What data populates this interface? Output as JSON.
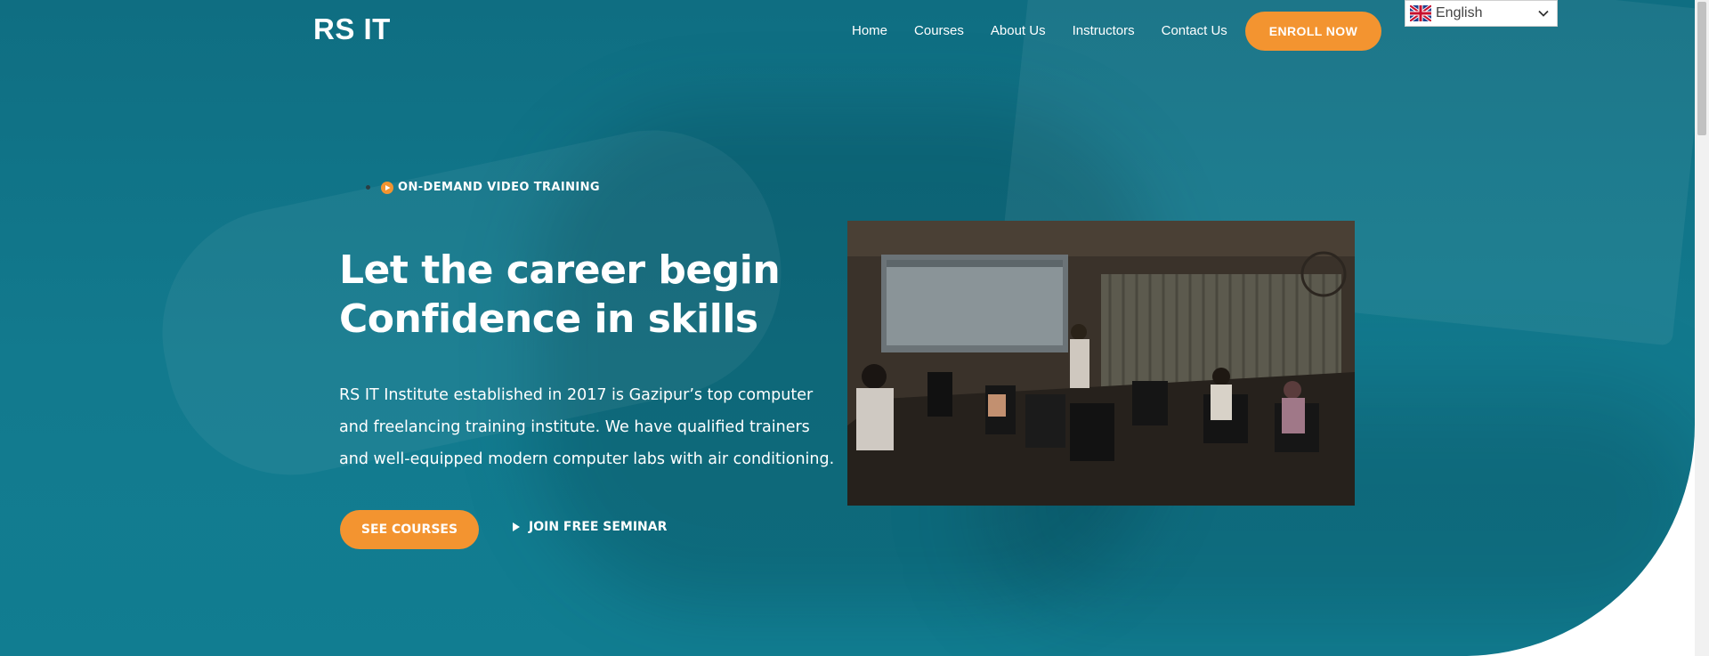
{
  "brand": {
    "logo": "RS IT"
  },
  "nav": {
    "items": [
      "Home",
      "Courses",
      "About Us",
      "Instructors",
      "Contact Us"
    ],
    "enroll_label": "ENROLL NOW"
  },
  "language": {
    "selected": "English",
    "flag_icon": "uk-flag-icon"
  },
  "hero": {
    "tagline": "ON-DEMAND VIDEO TRAINING",
    "headline_line1": "Let the career begin",
    "headline_line2": "Confidence in skills",
    "description": "RS IT Institute established in 2017 is Gazipur’s top computer and freelancing training institute. We have qualified trainers and well-equipped modern computer labs with air conditioning.",
    "primary_button": "SEE COURSES",
    "secondary_link": "JOIN FREE SEMINAR"
  },
  "colors": {
    "hero_bg": "#117d91",
    "accent": "#f39430",
    "text": "#ffffff"
  }
}
